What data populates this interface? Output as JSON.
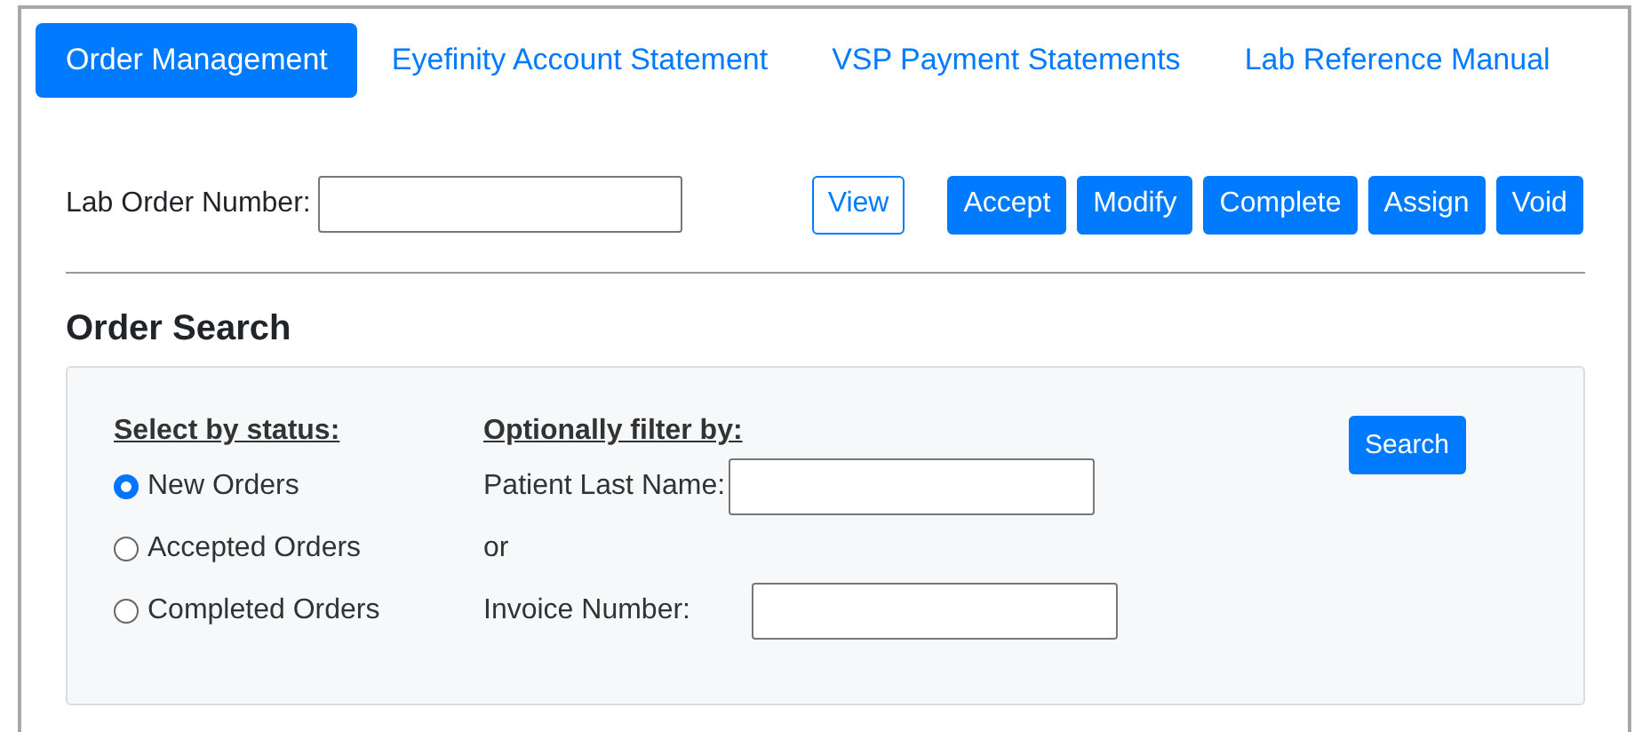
{
  "tabs": [
    {
      "label": "Order Management",
      "selected": true
    },
    {
      "label": "Eyefinity Account Statement",
      "selected": false
    },
    {
      "label": "VSP Payment Statements",
      "selected": false
    },
    {
      "label": "Lab Reference Manual",
      "selected": false
    }
  ],
  "lab_order": {
    "label": "Lab Order Number:",
    "view_button": "View",
    "actions": [
      "Accept",
      "Modify",
      "Complete",
      "Assign",
      "Void"
    ]
  },
  "order_search": {
    "title": "Order Search",
    "status_heading": "Select by status:",
    "statuses": [
      {
        "label": "New Orders",
        "selected": true
      },
      {
        "label": "Accepted Orders",
        "selected": false
      },
      {
        "label": "Completed Orders",
        "selected": false
      }
    ],
    "filter_heading": "Optionally filter by:",
    "patient_label": "Patient Last Name:",
    "or": "or",
    "invoice_label": "Invoice Number:",
    "search_button": "Search"
  }
}
